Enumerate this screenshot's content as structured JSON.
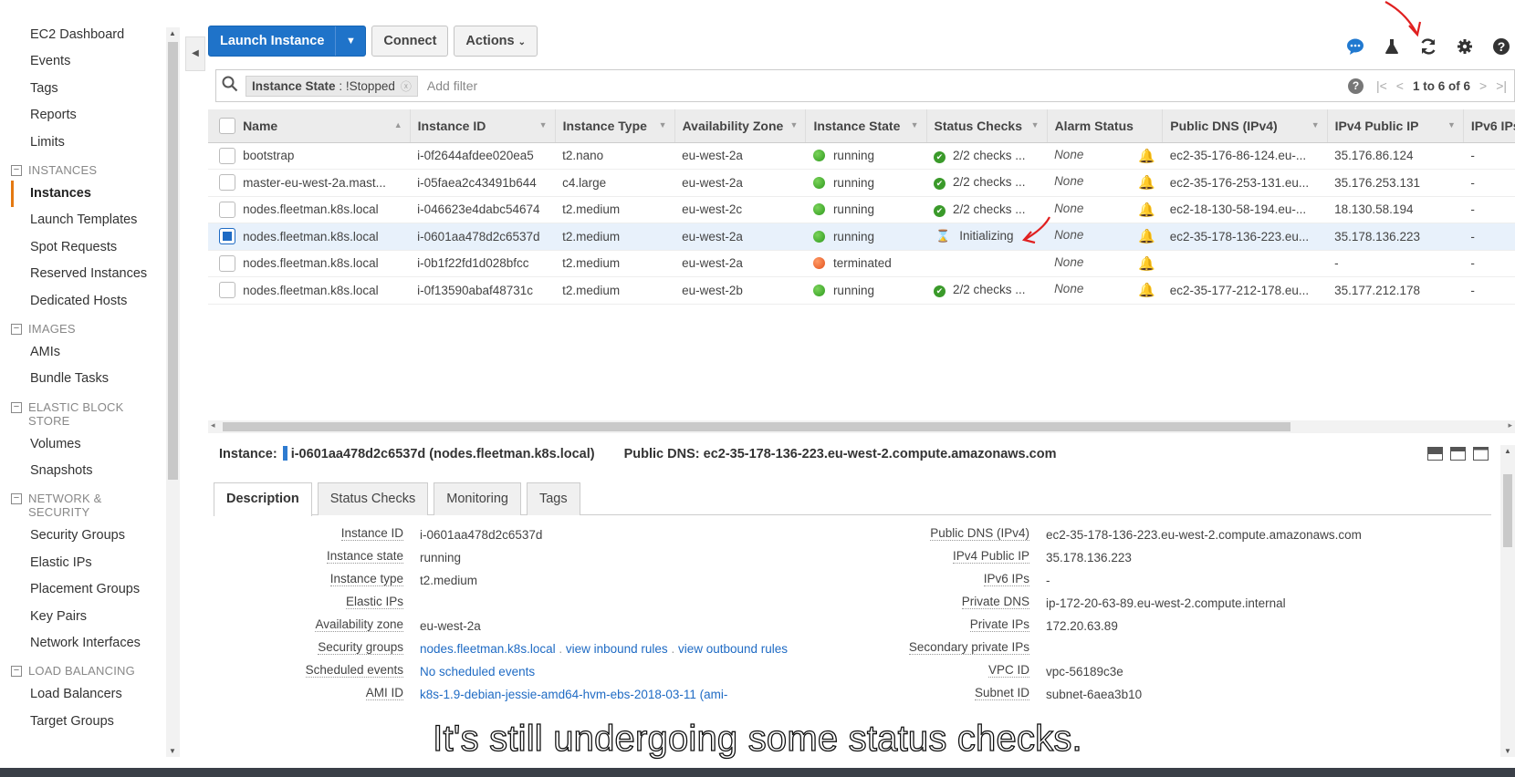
{
  "sidebar": {
    "items": [
      {
        "type": "link",
        "label": "EC2 Dashboard"
      },
      {
        "type": "link",
        "label": "Events"
      },
      {
        "type": "link",
        "label": "Tags"
      },
      {
        "type": "link",
        "label": "Reports"
      },
      {
        "type": "link",
        "label": "Limits"
      },
      {
        "type": "section",
        "label": "INSTANCES"
      },
      {
        "type": "link",
        "label": "Instances",
        "active": true
      },
      {
        "type": "link",
        "label": "Launch Templates"
      },
      {
        "type": "link",
        "label": "Spot Requests"
      },
      {
        "type": "link",
        "label": "Reserved Instances"
      },
      {
        "type": "link",
        "label": "Dedicated Hosts"
      },
      {
        "type": "section",
        "label": "IMAGES"
      },
      {
        "type": "link",
        "label": "AMIs"
      },
      {
        "type": "link",
        "label": "Bundle Tasks"
      },
      {
        "type": "section",
        "label": "ELASTIC BLOCK STORE"
      },
      {
        "type": "link",
        "label": "Volumes"
      },
      {
        "type": "link",
        "label": "Snapshots"
      },
      {
        "type": "section",
        "label": "NETWORK & SECURITY"
      },
      {
        "type": "link",
        "label": "Security Groups"
      },
      {
        "type": "link",
        "label": "Elastic IPs"
      },
      {
        "type": "link",
        "label": "Placement Groups"
      },
      {
        "type": "link",
        "label": "Key Pairs"
      },
      {
        "type": "link",
        "label": "Network Interfaces"
      },
      {
        "type": "section",
        "label": "LOAD BALANCING"
      },
      {
        "type": "link",
        "label": "Load Balancers"
      },
      {
        "type": "link",
        "label": "Target Groups"
      }
    ]
  },
  "toolbar": {
    "launch_label": "Launch Instance",
    "connect_label": "Connect",
    "actions_label": "Actions"
  },
  "filter": {
    "chip_key": "Instance State",
    "chip_value": ": !Stopped",
    "placeholder": "Add filter",
    "pager_text": "1 to 6 of 6"
  },
  "table": {
    "columns": [
      "Name",
      "Instance ID",
      "Instance Type",
      "Availability Zone",
      "Instance State",
      "Status Checks",
      "Alarm Status",
      "Public DNS (IPv4)",
      "IPv4 Public IP",
      "IPv6 IPs"
    ],
    "rows": [
      {
        "name": "bootstrap",
        "id": "i-0f2644afdee020ea5",
        "type": "t2.nano",
        "az": "eu-west-2a",
        "state": "running",
        "state_color": "green",
        "checks": "2/2 checks ...",
        "checks_kind": "ok",
        "alarm": "None",
        "dns": "ec2-35-176-86-124.eu-...",
        "ip": "35.176.86.124",
        "ipv6": "-",
        "selected": false
      },
      {
        "name": "master-eu-west-2a.mast...",
        "id": "i-05faea2c43491b644",
        "type": "c4.large",
        "az": "eu-west-2a",
        "state": "running",
        "state_color": "green",
        "checks": "2/2 checks ...",
        "checks_kind": "ok",
        "alarm": "None",
        "dns": "ec2-35-176-253-131.eu...",
        "ip": "35.176.253.131",
        "ipv6": "-",
        "selected": false
      },
      {
        "name": "nodes.fleetman.k8s.local",
        "id": "i-046623e4dabc54674",
        "type": "t2.medium",
        "az": "eu-west-2c",
        "state": "running",
        "state_color": "green",
        "checks": "2/2 checks ...",
        "checks_kind": "ok",
        "alarm": "None",
        "dns": "ec2-18-130-58-194.eu-...",
        "ip": "18.130.58.194",
        "ipv6": "-",
        "selected": false
      },
      {
        "name": "nodes.fleetman.k8s.local",
        "id": "i-0601aa478d2c6537d",
        "type": "t2.medium",
        "az": "eu-west-2a",
        "state": "running",
        "state_color": "green",
        "checks": "Initializing",
        "checks_kind": "init",
        "alarm": "None",
        "dns": "ec2-35-178-136-223.eu...",
        "ip": "35.178.136.223",
        "ipv6": "-",
        "selected": true
      },
      {
        "name": "nodes.fleetman.k8s.local",
        "id": "i-0b1f22fd1d028bfcc",
        "type": "t2.medium",
        "az": "eu-west-2a",
        "state": "terminated",
        "state_color": "orange",
        "checks": "",
        "checks_kind": "none",
        "alarm": "None",
        "dns": "",
        "ip": "-",
        "ipv6": "-",
        "selected": false
      },
      {
        "name": "nodes.fleetman.k8s.local",
        "id": "i-0f13590abaf48731c",
        "type": "t2.medium",
        "az": "eu-west-2b",
        "state": "running",
        "state_color": "green",
        "checks": "2/2 checks ...",
        "checks_kind": "ok",
        "alarm": "None",
        "dns": "ec2-35-177-212-178.eu...",
        "ip": "35.177.212.178",
        "ipv6": "-",
        "selected": false
      }
    ]
  },
  "detail": {
    "instance_label": "Instance:",
    "instance_value": "i-0601aa478d2c6537d (nodes.fleetman.k8s.local)",
    "dns_label": "Public DNS:",
    "dns_value": "ec2-35-178-136-223.eu-west-2.compute.amazonaws.com",
    "tabs": [
      "Description",
      "Status Checks",
      "Monitoring",
      "Tags"
    ],
    "left": [
      {
        "label": "Instance ID",
        "value": "i-0601aa478d2c6537d"
      },
      {
        "label": "Instance state",
        "value": "running"
      },
      {
        "label": "Instance type",
        "value": "t2.medium"
      },
      {
        "label": "Elastic IPs",
        "value": ""
      },
      {
        "label": "Availability zone",
        "value": "eu-west-2a"
      },
      {
        "label": "Security groups",
        "links": [
          "nodes.fleetman.k8s.local",
          "view inbound rules",
          "view outbound rules"
        ]
      },
      {
        "label": "Scheduled events",
        "links": [
          "No scheduled events"
        ]
      },
      {
        "label": "AMI ID",
        "links": [
          "k8s-1.9-debian-jessie-amd64-hvm-ebs-2018-03-11 (ami-"
        ]
      }
    ],
    "right": [
      {
        "label": "Public DNS (IPv4)",
        "value": "ec2-35-178-136-223.eu-west-2.compute.amazonaws.com"
      },
      {
        "label": "IPv4 Public IP",
        "value": "35.178.136.223"
      },
      {
        "label": "IPv6 IPs",
        "value": "-"
      },
      {
        "label": "Private DNS",
        "value": "ip-172-20-63-89.eu-west-2.compute.internal"
      },
      {
        "label": "Private IPs",
        "value": "172.20.63.89"
      },
      {
        "label": "Secondary private IPs",
        "value": ""
      },
      {
        "label": "VPC ID",
        "value": "vpc-56189c3e"
      },
      {
        "label": "Subnet ID",
        "value": "subnet-6aea3b10"
      }
    ]
  },
  "caption": "It's still undergoing some status checks.",
  "colors": {
    "primary": "#1f73c9",
    "annotation": "#e02020",
    "running": "#2f9a1e",
    "terminated": "#e2521c"
  }
}
